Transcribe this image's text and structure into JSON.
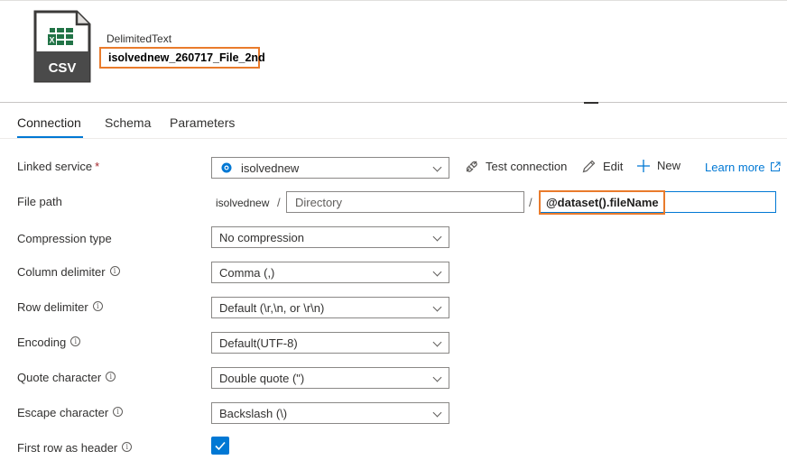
{
  "dataset": {
    "icon_label": "CSV",
    "type": "DelimitedText",
    "name": "isolvednew_260717_File_2nd"
  },
  "tabs": [
    {
      "label": "Connection",
      "active": true
    },
    {
      "label": "Schema",
      "active": false
    },
    {
      "label": "Parameters",
      "active": false
    }
  ],
  "linked_service": {
    "label": "Linked service",
    "required_mark": "*",
    "value": "isolvednew",
    "test_connection": "Test connection",
    "edit": "Edit",
    "new": "New",
    "learn_more": "Learn more"
  },
  "file_path": {
    "label": "File path",
    "container": "isolvednew",
    "separator": "/",
    "directory_placeholder": "Directory",
    "file_name": "@dataset().fileName"
  },
  "compression_type": {
    "label": "Compression type",
    "value": "No compression"
  },
  "column_delimiter": {
    "label": "Column delimiter",
    "value": "Comma (,)"
  },
  "row_delimiter": {
    "label": "Row delimiter",
    "value": "Default (\\r,\\n, or \\r\\n)"
  },
  "encoding": {
    "label": "Encoding",
    "value": "Default(UTF-8)"
  },
  "quote_character": {
    "label": "Quote character",
    "value": "Double quote (\")"
  },
  "escape_character": {
    "label": "Escape character",
    "value": "Backslash (\\)"
  },
  "first_row_as_header": {
    "label": "First row as header",
    "checked": true
  },
  "colors": {
    "accent": "#0078d4",
    "highlight": "#e97b2c",
    "excel_green": "#217346"
  }
}
